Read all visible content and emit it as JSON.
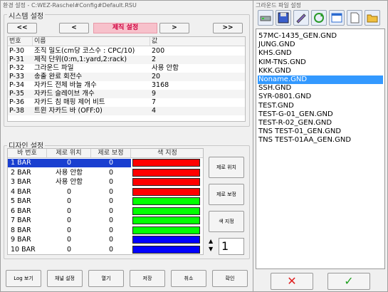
{
  "main_window": {
    "title": "환경 설정 - C:WEZ-Raschel#Config#Default.RSU"
  },
  "system_settings": {
    "group_label": "시스템 설정",
    "nav": {
      "first": "<<",
      "prev": "<",
      "section_title": "제직 설정",
      "next": ">",
      "last": ">>"
    },
    "columns": [
      "번호",
      "이름",
      "값"
    ],
    "rows": [
      {
        "id": "P-30",
        "name": "조직 밀도(cm당 코스수 : CPC/10)",
        "value": "200"
      },
      {
        "id": "P-31",
        "name": "제직 단위(0:m,1:yard,2:rack)",
        "value": "2"
      },
      {
        "id": "P-32",
        "name": "그라운드 파일",
        "value": "사용 안함"
      },
      {
        "id": "P-33",
        "name": "송출 완료 회전수",
        "value": "20"
      },
      {
        "id": "P-34",
        "name": "자카드 전체 바늘 개수",
        "value": "3168"
      },
      {
        "id": "P-35",
        "name": "자카드 슬레이브 개수",
        "value": "9"
      },
      {
        "id": "P-36",
        "name": "자카드 침 매핑 제어 비트",
        "value": "7"
      },
      {
        "id": "P-38",
        "name": "트윈 자카드 바 (OFF:0)",
        "value": "4"
      }
    ]
  },
  "design_settings": {
    "group_label": "디자인 설정",
    "columns": [
      "바 번호",
      "제로 위치",
      "제로 보정",
      "색 지정"
    ],
    "rows": [
      {
        "bar": "1 BAR",
        "zero_pos": "0",
        "zero_corr": "0",
        "color": "#ff0000"
      },
      {
        "bar": "2 BAR",
        "zero_pos": "사용 안함",
        "zero_corr": "0",
        "color": "#ff0000"
      },
      {
        "bar": "3 BAR",
        "zero_pos": "사용 안함",
        "zero_corr": "0",
        "color": "#ff0000"
      },
      {
        "bar": "4 BAR",
        "zero_pos": "0",
        "zero_corr": "0",
        "color": "#ff0000"
      },
      {
        "bar": "5 BAR",
        "zero_pos": "0",
        "zero_corr": "0",
        "color": "#00ff00"
      },
      {
        "bar": "6 BAR",
        "zero_pos": "0",
        "zero_corr": "0",
        "color": "#00ff00"
      },
      {
        "bar": "7 BAR",
        "zero_pos": "0",
        "zero_corr": "0",
        "color": "#00ff00"
      },
      {
        "bar": "8 BAR",
        "zero_pos": "0",
        "zero_corr": "0",
        "color": "#00ff00"
      },
      {
        "bar": "9 BAR",
        "zero_pos": "0",
        "zero_corr": "0",
        "color": "#0000ff"
      },
      {
        "bar": "10 BAR",
        "zero_pos": "0",
        "zero_corr": "0",
        "color": "#0000ff"
      }
    ],
    "side_buttons": {
      "zero_position": "제로 위치",
      "zero_correction": "제로 보정",
      "color_assign": "색 지정"
    },
    "stepper_value": "1"
  },
  "bottom_buttons": {
    "log_view": "Log 보기",
    "channel_setting": "채널 설정",
    "open": "열기",
    "save": "저장",
    "cancel": "취소",
    "confirm": "확인"
  },
  "file_window": {
    "title": "그라운드 파일 설정",
    "toolbar_icons": [
      "drive-icon",
      "save-disk-icon",
      "edit-icon",
      "refresh-icon",
      "window-icon",
      "new-file-icon",
      "open-folder-icon"
    ],
    "files": [
      "57MC-1435_GEN.GND",
      "JUNG.GND",
      "KHS.GND",
      "KIM-TNS.GND",
      "KKK.GND",
      "Noname.GND",
      "SSH.GND",
      "SYR-0801.GND",
      "TEST.GND",
      "TEST-G-01_GEN.GND",
      "TEST-R-02_GEN.GND",
      "TNS TEST-01_GEN.GND",
      "TNS TEST-01AA_GEN.GND"
    ],
    "selected_file": "Noname.GND",
    "cancel_symbol": "✕",
    "ok_symbol": "✓",
    "colors": {
      "cancel": "#e02020",
      "ok": "#20a020",
      "selection": "#3399ff"
    }
  }
}
